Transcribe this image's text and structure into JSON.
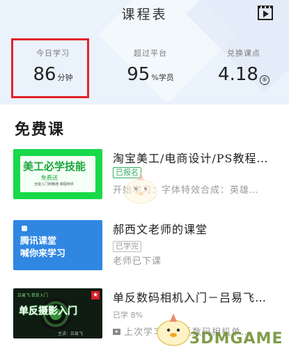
{
  "header": {
    "title": "课程表",
    "play_icon": "video-play-icon",
    "stats": [
      {
        "label": "今日学习",
        "value": "86",
        "unit": "分钟"
      },
      {
        "label": "超过平台",
        "value": "95",
        "unit": "%学员"
      },
      {
        "label": "兑换课点",
        "value": "4.18",
        "unit_icon": "coin-icon"
      }
    ],
    "highlight_color": "#e2232a"
  },
  "section": {
    "title": "免费课"
  },
  "courses": [
    {
      "title": "淘宝美工/电商设计/PS教程…",
      "tag": "已报名",
      "subtitle": "开始学习：字体特效合成：英雄…",
      "thumb": {
        "text": "美工必学技能",
        "line2": "免费送",
        "line3": "全能入门到精通 课程特供"
      }
    },
    {
      "title": "郝西文老师的课堂",
      "tag": "已学完",
      "subtitle": "老师已下课",
      "thumb": {
        "line1": "腾讯课堂",
        "line2": "喊你来学习"
      }
    },
    {
      "title": "单反数码相机入门－吕易飞…",
      "tag": "已学 8%",
      "subtitle": "上次学习：单反数码相机单…",
      "thumb": {
        "text": "单反摄影入门",
        "top": "吕易飞 单反入门",
        "author": "主讲：吕易飞"
      }
    }
  ],
  "watermark": {
    "text": "3DMGAME"
  }
}
